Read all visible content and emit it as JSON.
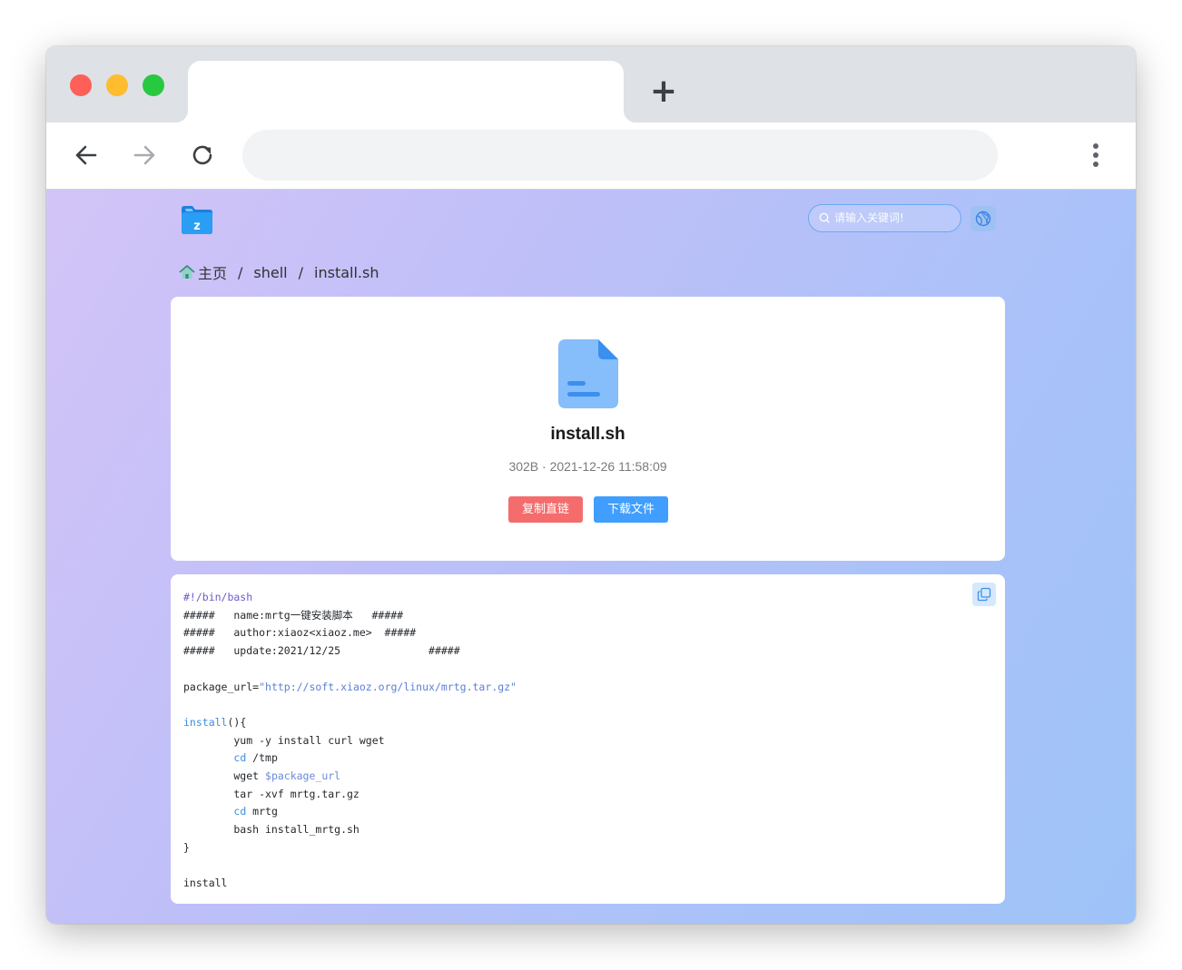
{
  "browser": {
    "tab_title": "",
    "new_tab_label": "+",
    "address": ""
  },
  "site": {
    "search_placeholder": "请输入关键词!"
  },
  "breadcrumb": {
    "home": "主页",
    "items": [
      "shell",
      "install.sh"
    ],
    "separator": "/"
  },
  "file": {
    "name": "install.sh",
    "meta": "302B · 2021-12-26 11:58:09",
    "copy_link_label": "复制直链",
    "download_label": "下载文件"
  },
  "code": {
    "lines": [
      "#!/bin/bash",
      "#####   name:mrtg一键安装脚本   #####",
      "#####   author:xiaoz<xiaoz.me>  #####",
      "#####   update:2021/12/25              #####",
      "",
      "package_url=\"http://soft.xiaoz.org/linux/mrtg.tar.gz\"",
      "",
      "install(){",
      "        yum -y install curl wget",
      "        cd /tmp",
      "        wget $package_url",
      "        tar -xvf mrtg.tar.gz",
      "        cd mrtg",
      "        bash install_mrtg.sh",
      "}",
      "",
      "install"
    ]
  },
  "colors": {
    "copy_button": "#f56c6c",
    "download_button": "#409eff",
    "file_icon": "#86bdfb"
  }
}
